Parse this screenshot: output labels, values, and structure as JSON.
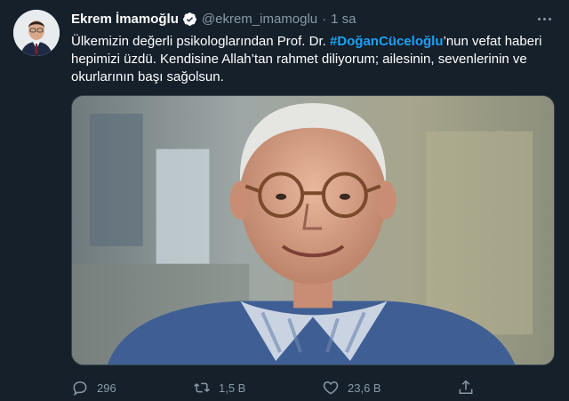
{
  "author": {
    "name": "Ekrem İmamoğlu",
    "handle": "@ekrem_imamoglu",
    "separator": "·",
    "time": "1 sa"
  },
  "tweet": {
    "text_before": "Ülkemizin değerli psikologlarından Prof. Dr. ",
    "hashtag": "#DoğanCüceloğlu",
    "text_after": "’nun vefat haberi hepimizi üzdü. Kendisine Allah’tan rahmet diliyorum; ailesinin, sevenlerinin ve okurlarının başı sağolsun."
  },
  "actions": {
    "reply_count": "296",
    "retweet_count": "1,5 B",
    "like_count": "23,6 B"
  },
  "colors": {
    "background": "#15202b",
    "secondary_text": "#8899a6",
    "accent": "#1da1f2"
  },
  "icons": {
    "verified": "verified-badge-icon",
    "more": "more-icon",
    "reply": "reply-icon",
    "retweet": "retweet-icon",
    "like": "heart-icon",
    "share": "share-icon"
  }
}
